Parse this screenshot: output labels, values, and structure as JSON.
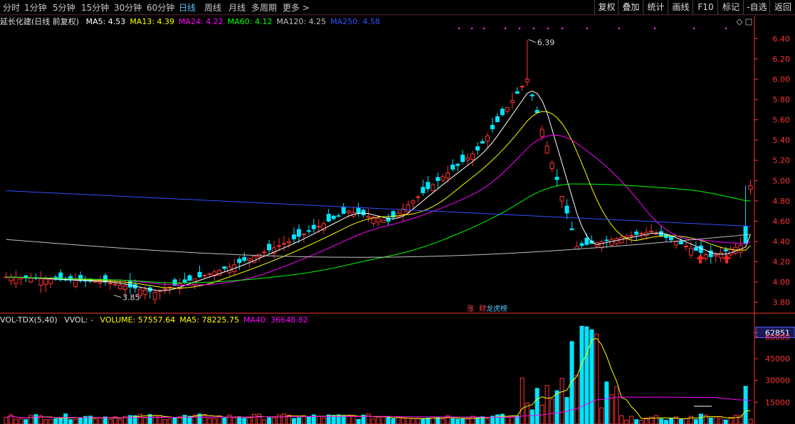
{
  "toolbar": {
    "periods": [
      "分时",
      "1分钟",
      "5分钟",
      "15分钟",
      "30分钟",
      "60分钟",
      "日线",
      "周线",
      "月线",
      "多周期",
      "更多 >"
    ],
    "active_period": "日线",
    "right_buttons": [
      "复权",
      "叠加",
      "统计",
      "画线",
      "F10",
      "标记",
      "-自选",
      "返回"
    ]
  },
  "title": {
    "stock": "延长化建(日线 前复权)",
    "ma_items": [
      {
        "label": "MA5: 4.53",
        "color": "#ffffff"
      },
      {
        "label": "MA13: 4.39",
        "color": "#ffff00"
      },
      {
        "label": "MA24: 4.22",
        "color": "#ff00ff"
      },
      {
        "label": "MA60: 4.12",
        "color": "#00ff00"
      },
      {
        "label": "MA120: 4.25",
        "color": "#c0c0c0"
      },
      {
        "label": "MA250: 4.58",
        "color": "#3050ff"
      }
    ]
  },
  "volume_info": {
    "name": "VOL-TDX(5,40)",
    "vvol": "VVOL: -",
    "items": [
      {
        "label": "VOLUME: 57557.64",
        "color": "#ffff00"
      },
      {
        "label": "MA5: 78225.75",
        "color": "#ffff00"
      },
      {
        "label": "MA40: 36648.82",
        "color": "#ff00ff"
      }
    ]
  },
  "annotations": {
    "high_label": "6.39",
    "low_label": "3.85",
    "event_mark_1": "涨",
    "event_mark_2": "财",
    "event_mark_3": "龙虎榜"
  },
  "colors": {
    "up": "#ff3232",
    "down": "#00e5ff",
    "axis": "#ff3232",
    "grid": "#3a0000"
  },
  "chart_data": [
    {
      "type": "candlestick",
      "title": "延长化建(日线 前复权)",
      "ylim": [
        3.7,
        6.5
      ],
      "y_ticks": [
        "6.40",
        "6.20",
        "6.00",
        "5.80",
        "5.60",
        "5.40",
        "5.20",
        "5.00",
        "4.80",
        "4.60",
        "4.40",
        "4.20",
        "4.00",
        "3.80"
      ],
      "high": 6.39,
      "low": 3.85,
      "last_close": 4.95,
      "series": [
        {
          "name": "MA5",
          "value": 4.53
        },
        {
          "name": "MA13",
          "value": 4.39
        },
        {
          "name": "MA24",
          "value": 4.22
        },
        {
          "name": "MA60",
          "value": 4.12
        },
        {
          "name": "MA120",
          "value": 4.25
        },
        {
          "name": "MA250",
          "value": 4.58
        }
      ]
    },
    {
      "type": "bar",
      "title": "VOL-TDX(5,40)",
      "ylim": [
        0,
        68000
      ],
      "y_ticks": [
        "62851",
        "60000",
        "45000",
        "30000",
        "15000"
      ],
      "series": [
        {
          "name": "VOLUME",
          "value": 57557.64
        },
        {
          "name": "MA5",
          "value": 78225.75
        },
        {
          "name": "MA40",
          "value": 36648.82
        }
      ]
    }
  ]
}
